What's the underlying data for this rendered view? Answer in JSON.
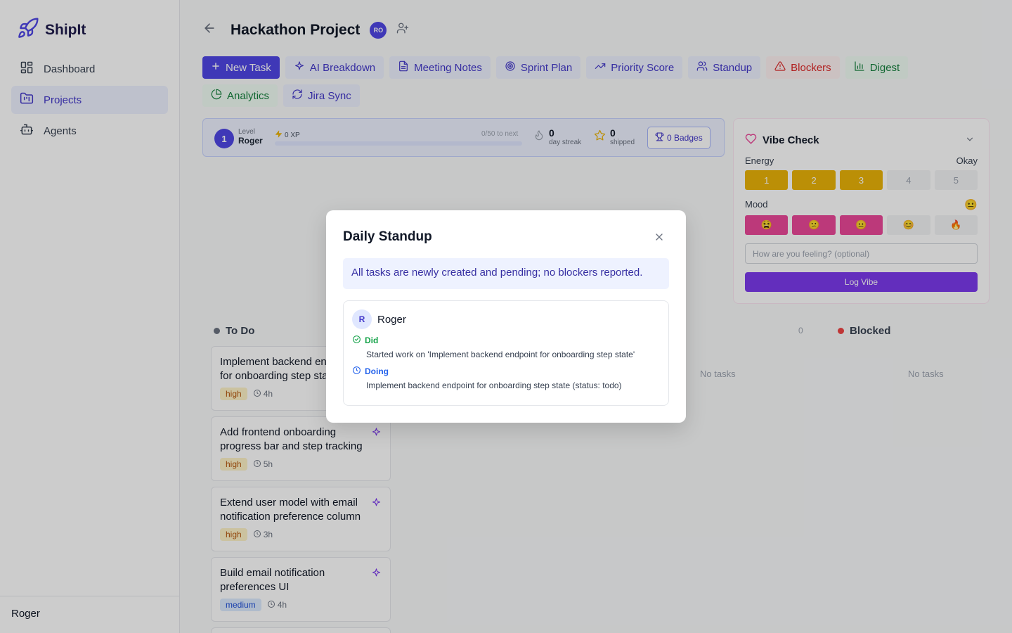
{
  "app": {
    "name": "ShipIt",
    "user": "Roger"
  },
  "sidebar": {
    "items": [
      {
        "label": "Dashboard",
        "icon": "dashboard-icon"
      },
      {
        "label": "Projects",
        "icon": "folder-kanban-icon",
        "active": true
      },
      {
        "label": "Agents",
        "icon": "bot-icon"
      }
    ]
  },
  "header": {
    "title": "Hackathon Project",
    "avatar_initials": "RO"
  },
  "toolbar": {
    "buttons": [
      {
        "label": "New Task",
        "icon": "plus-icon",
        "style": "primary"
      },
      {
        "label": "AI Breakdown",
        "icon": "sparkles-icon"
      },
      {
        "label": "Meeting Notes",
        "icon": "file-text-icon"
      },
      {
        "label": "Sprint Plan",
        "icon": "target-icon"
      },
      {
        "label": "Priority Score",
        "icon": "trending-up-icon"
      },
      {
        "label": "Standup",
        "icon": "users-icon"
      },
      {
        "label": "Blockers",
        "icon": "alert-triangle-icon",
        "style": "red"
      },
      {
        "label": "Digest",
        "icon": "bar-chart-icon",
        "style": "green"
      },
      {
        "label": "Analytics",
        "icon": "pie-chart-icon",
        "style": "green"
      },
      {
        "label": "Jira Sync",
        "icon": "refresh-icon"
      }
    ]
  },
  "progress": {
    "level": "1",
    "level_label": "Level",
    "name": "Roger",
    "xp": "0 XP",
    "xp_next": "0/50 to next",
    "xp_fraction": 0,
    "streak": "0",
    "streak_label": "day streak",
    "shipped": "0",
    "shipped_label": "shipped",
    "badges": "0 Badges"
  },
  "vibe": {
    "title": "Vibe Check",
    "energy_label": "Energy",
    "energy_value": "Okay",
    "energy_options": [
      "1",
      "2",
      "3",
      "4",
      "5"
    ],
    "energy_selected": 3,
    "mood_label": "Mood",
    "mood_value": "😐",
    "mood_options": [
      "😫",
      "😕",
      "😐",
      "😊",
      "🔥"
    ],
    "mood_selected": 3,
    "placeholder": "How are you feeling? (optional)",
    "log_label": "Log Vibe"
  },
  "board": {
    "todo_label": "To Do",
    "count": "0",
    "blocked_label": "Blocked",
    "empty_text": "No tasks",
    "tasks": [
      {
        "title": "Implement backend endpoint for onboarding step state",
        "priority": "high",
        "estimate": "4h"
      },
      {
        "title": "Add frontend onboarding progress bar and step tracking",
        "priority": "high",
        "estimate": "5h"
      },
      {
        "title": "Extend user model with email notification preference column",
        "priority": "high",
        "estimate": "3h"
      },
      {
        "title": "Build email notification preferences UI",
        "priority": "medium",
        "estimate": "4h"
      }
    ]
  },
  "modal": {
    "title": "Daily Standup",
    "summary": "All tasks are newly created and pending; no blockers reported.",
    "member": {
      "initial": "R",
      "name": "Roger",
      "did_label": "Did",
      "did_text": "Started work on 'Implement backend endpoint for onboarding step state'",
      "doing_label": "Doing",
      "doing_text": "Implement backend endpoint for onboarding step state (status: todo)"
    }
  },
  "colors": {
    "accent": "#4f46e5",
    "vibe": "#7c3aed",
    "energy_on": "#eab308",
    "mood_on": "#ec4899",
    "blocked": "#ef4444"
  }
}
